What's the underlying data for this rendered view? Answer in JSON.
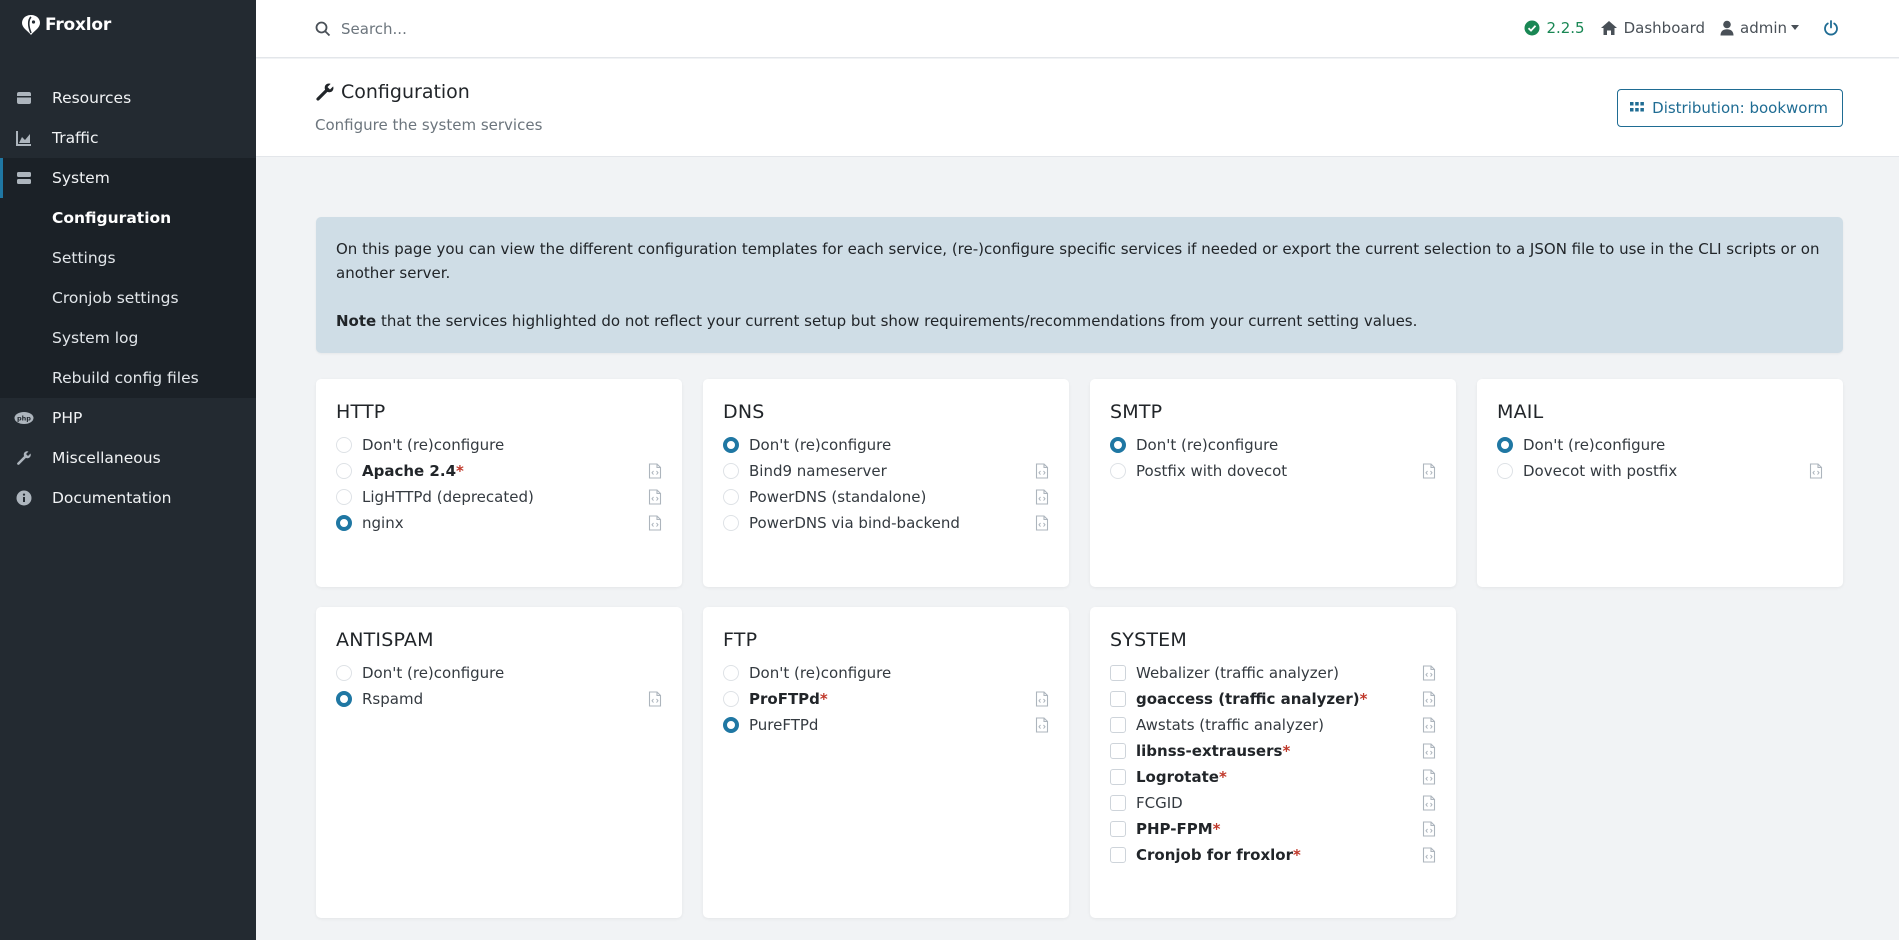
{
  "brand": {
    "name": "Froxlor"
  },
  "sidebar": {
    "items": [
      {
        "label": "Resources",
        "icon": "database-icon"
      },
      {
        "label": "Traffic",
        "icon": "chart-area-icon"
      },
      {
        "label": "System",
        "icon": "server-icon",
        "active": true
      },
      {
        "label": "PHP",
        "icon": "php-icon"
      },
      {
        "label": "Miscellaneous",
        "icon": "wrench-icon"
      },
      {
        "label": "Documentation",
        "icon": "info-circle-icon"
      }
    ],
    "system_sub": [
      "Configuration",
      "Settings",
      "Cronjob settings",
      "System log",
      "Rebuild config files"
    ]
  },
  "topbar": {
    "search_placeholder": "Search...",
    "version": "2.2.5",
    "dashboard": "Dashboard",
    "user": "admin"
  },
  "header": {
    "title": "Configuration",
    "subtitle": "Configure the system services",
    "distribution_button": "Distribution: bookworm"
  },
  "alert": {
    "text1": "On this page you can view the different configuration templates for each service, (re-)configure specific services if needed or export the current selection to a JSON file to use in the CLI scripts or on another server.",
    "note_bold": "Note",
    "note_rest": " that the services highlighted do not reflect your current setup but show requirements/recommendations from your current setting values."
  },
  "cards": {
    "http": {
      "title": "HTTP",
      "options": [
        "Don't (re)configure",
        "Apache 2.4",
        "LigHTTPd (deprecated)",
        "nginx"
      ]
    },
    "dns": {
      "title": "DNS",
      "options": [
        "Don't (re)configure",
        "Bind9 nameserver",
        "PowerDNS (standalone)",
        "PowerDNS via bind-backend"
      ]
    },
    "smtp": {
      "title": "SMTP",
      "options": [
        "Don't (re)configure",
        "Postfix with dovecot"
      ]
    },
    "mail": {
      "title": "MAIL",
      "options": [
        "Don't (re)configure",
        "Dovecot with postfix"
      ]
    },
    "antispam": {
      "title": "ANTISPAM",
      "options": [
        "Don't (re)configure",
        "Rspamd"
      ]
    },
    "ftp": {
      "title": "FTP",
      "options": [
        "Don't (re)configure",
        "ProFTPd",
        "PureFTPd"
      ]
    },
    "system": {
      "title": "SYSTEM",
      "options": [
        "Webalizer (traffic analyzer)",
        "goaccess (traffic analyzer)",
        "Awstats (traffic analyzer)",
        "libnss-extrausers",
        "Logrotate",
        "FCGID",
        "PHP-FPM",
        "Cronjob for froxlor"
      ]
    }
  },
  "required_marker": "*",
  "colors": {
    "sidebar_bg": "#232a31",
    "accent": "#1f77a3",
    "alert_bg": "#cfdde6",
    "version_green": "#198754",
    "required_red": "#c0392b"
  }
}
